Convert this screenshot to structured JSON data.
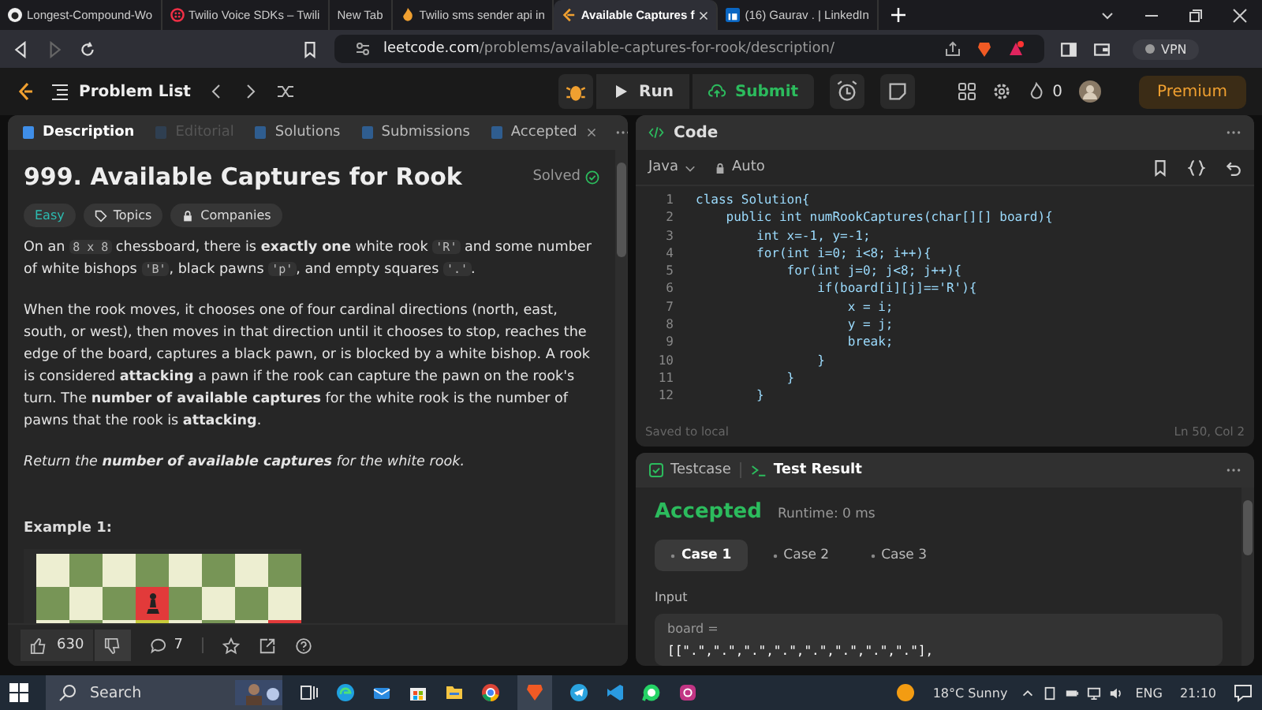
{
  "browser_tabs": [
    {
      "title": "Longest-Compound-Wo",
      "selected": false
    },
    {
      "title": "Twilio Voice SDKs – Twili",
      "selected": false
    },
    {
      "title": "New Tab",
      "selected": false
    },
    {
      "title": "Twilio sms sender api in",
      "selected": false
    },
    {
      "title": "Available Captures f",
      "selected": true
    },
    {
      "title": "(16) Gaurav . | LinkedIn",
      "selected": false
    }
  ],
  "address_bar": {
    "host": "leetcode.com",
    "path": "/problems/available-captures-for-rook/description/"
  },
  "vpn_label": "VPN",
  "nav": {
    "problem_list": "Problem List",
    "run": "Run",
    "submit": "Submit",
    "streak": "0",
    "premium": "Premium"
  },
  "description_tabs": [
    {
      "label": "Description",
      "selected": true,
      "disabled": false,
      "closable": false
    },
    {
      "label": "Editorial",
      "selected": false,
      "disabled": true,
      "closable": false
    },
    {
      "label": "Solutions",
      "selected": false,
      "disabled": false,
      "closable": false
    },
    {
      "label": "Submissions",
      "selected": false,
      "disabled": false,
      "closable": false
    },
    {
      "label": "Accepted",
      "selected": false,
      "disabled": false,
      "closable": true
    }
  ],
  "problem": {
    "title": "999. Available Captures for Rook",
    "status": "Solved",
    "difficulty": "Easy",
    "tags": [
      "Topics",
      "Companies"
    ],
    "paragraphs": [
      [
        {
          "kind": "text",
          "text": "On an "
        },
        {
          "kind": "code",
          "text": "8 x 8"
        },
        {
          "kind": "text",
          "text": " chessboard, there is "
        },
        {
          "kind": "bold",
          "text": "exactly one"
        },
        {
          "kind": "text",
          "text": " white rook "
        },
        {
          "kind": "code",
          "text": "'R'"
        },
        {
          "kind": "text",
          "text": " and some number of white bishops "
        },
        {
          "kind": "code",
          "text": "'B'"
        },
        {
          "kind": "text",
          "text": ", black pawns "
        },
        {
          "kind": "code",
          "text": "'p'"
        },
        {
          "kind": "text",
          "text": ", and empty squares "
        },
        {
          "kind": "code",
          "text": "'.'"
        },
        {
          "kind": "text",
          "text": "."
        }
      ],
      [
        {
          "kind": "text",
          "text": "When the rook moves, it chooses one of four cardinal directions (north, east, south, or west), then moves in that direction until it chooses to stop, reaches the edge of the board, captures a black pawn, or is blocked by a white bishop. A rook is considered "
        },
        {
          "kind": "bold",
          "text": "attacking"
        },
        {
          "kind": "text",
          "text": " a pawn if the rook can capture the pawn on the rook's turn. The "
        },
        {
          "kind": "bold",
          "text": "number of available captures"
        },
        {
          "kind": "text",
          "text": " for the white rook is the number of pawns that the rook is "
        },
        {
          "kind": "bold",
          "text": "attacking"
        },
        {
          "kind": "text",
          "text": "."
        }
      ],
      [
        {
          "kind": "italic",
          "text": "Return the "
        },
        {
          "kind": "bolditalic",
          "text": "number of available captures"
        },
        {
          "kind": "italic",
          "text": " for the white rook."
        }
      ]
    ],
    "example_heading": "Example 1:"
  },
  "footer": {
    "likes": "630",
    "comments": "7"
  },
  "code_panel": {
    "title": "Code",
    "language": "Java",
    "mode": "Auto",
    "line_numbers": [
      "1",
      "2",
      "3",
      "4",
      "5",
      "6",
      "7",
      "8",
      "9",
      "10",
      "11",
      "12"
    ],
    "lines": [
      "class Solution{",
      "    public int numRookCaptures(char[][] board){",
      "        int x=-1, y=-1;",
      "        for(int i=0; i<8; i++){",
      "            for(int j=0; j<8; j++){",
      "                if(board[i][j]=='R'){",
      "                    x = i;",
      "                    y = j;",
      "                    break;",
      "                }",
      "            }",
      "        }"
    ],
    "saved": "Saved to local",
    "cursor": "Ln 50, Col 2"
  },
  "result_tabs": [
    {
      "label": "Testcase",
      "selected": false
    },
    {
      "label": "Test Result",
      "selected": true
    }
  ],
  "result": {
    "verdict": "Accepted",
    "runtime": "Runtime: 0 ms",
    "cases": [
      {
        "label": "Case 1",
        "selected": true
      },
      {
        "label": "Case 2",
        "selected": false
      },
      {
        "label": "Case 3",
        "selected": false
      }
    ],
    "input_label": "Input",
    "variable": "board =",
    "value": "[[\".\",\".\",\".\",\".\",\".\",\".\",\".\",\".\"],"
  },
  "taskbar": {
    "search": "Search",
    "weather": "18°C  Sunny",
    "language": "ENG",
    "time": "21:10"
  }
}
